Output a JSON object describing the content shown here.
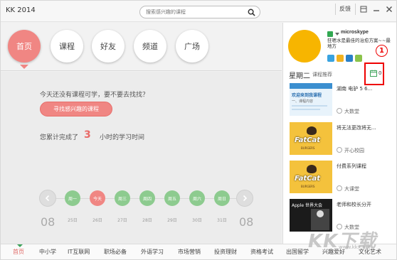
{
  "app": {
    "title": "KK 2014"
  },
  "search": {
    "placeholder": "搜索感兴趣的课程"
  },
  "titlebar": {
    "feedback_label": "反馈"
  },
  "nav": {
    "items": [
      {
        "label": "首页"
      },
      {
        "label": "课程"
      },
      {
        "label": "好友"
      },
      {
        "label": "频道"
      },
      {
        "label": "广场"
      }
    ]
  },
  "main": {
    "empty_text": "今天还没有课程可学，要不要去找找？",
    "find_button": "寻找感兴趣的课程",
    "study_prefix": "您累计完成了",
    "study_hours": "3",
    "study_suffix": "小时的学习时间"
  },
  "week": {
    "days": [
      {
        "label": "周一",
        "date": "25日"
      },
      {
        "label": "今天",
        "date": "26日"
      },
      {
        "label": "周三",
        "date": "27日"
      },
      {
        "label": "周四",
        "date": "28日"
      },
      {
        "label": "周五",
        "date": "29日"
      },
      {
        "label": "周六",
        "date": "30日"
      },
      {
        "label": "周日",
        "date": "31日"
      }
    ],
    "prev_date": "08",
    "next_date": "08"
  },
  "bottom": {
    "items": [
      "首页",
      "中小学",
      "IT互联网",
      "职场必备",
      "外语学习",
      "市场营销",
      "投资理财",
      "资格考试",
      "出国留学",
      "兴趣爱好",
      "文化艺术"
    ]
  },
  "user": {
    "name": "microskype",
    "motto": "狂嗯水是最佳的治愈方案~~最地方"
  },
  "schedule": {
    "weekday": "星期二",
    "label": "课程推荐",
    "count": "0",
    "annotation": "1"
  },
  "courses": [
    {
      "title": "湖南 电驴 5 6...",
      "author": "大数堂",
      "thumb_text": "欢迎来到我课程",
      "thumb_sub": "一、课程内容"
    },
    {
      "title": "将无法更改将无...",
      "author": "开心校园",
      "thumb_text": "FatCat",
      "thumb_sub": "BURGERS"
    },
    {
      "title": "付费系列课程",
      "author": "大课堂",
      "thumb_text": "FatCat",
      "thumb_sub": "BURGERS"
    },
    {
      "title": "老师和校长分开",
      "author": "大数堂",
      "thumb_text": "Apple 世界大会",
      "thumb_sub": ""
    }
  ],
  "watermark": {
    "text": "KK下载",
    "url": "www.kkx.net"
  },
  "colors": {
    "accent": "#f08683",
    "green": "#8dcb8f",
    "annotation": "#ee0000"
  }
}
